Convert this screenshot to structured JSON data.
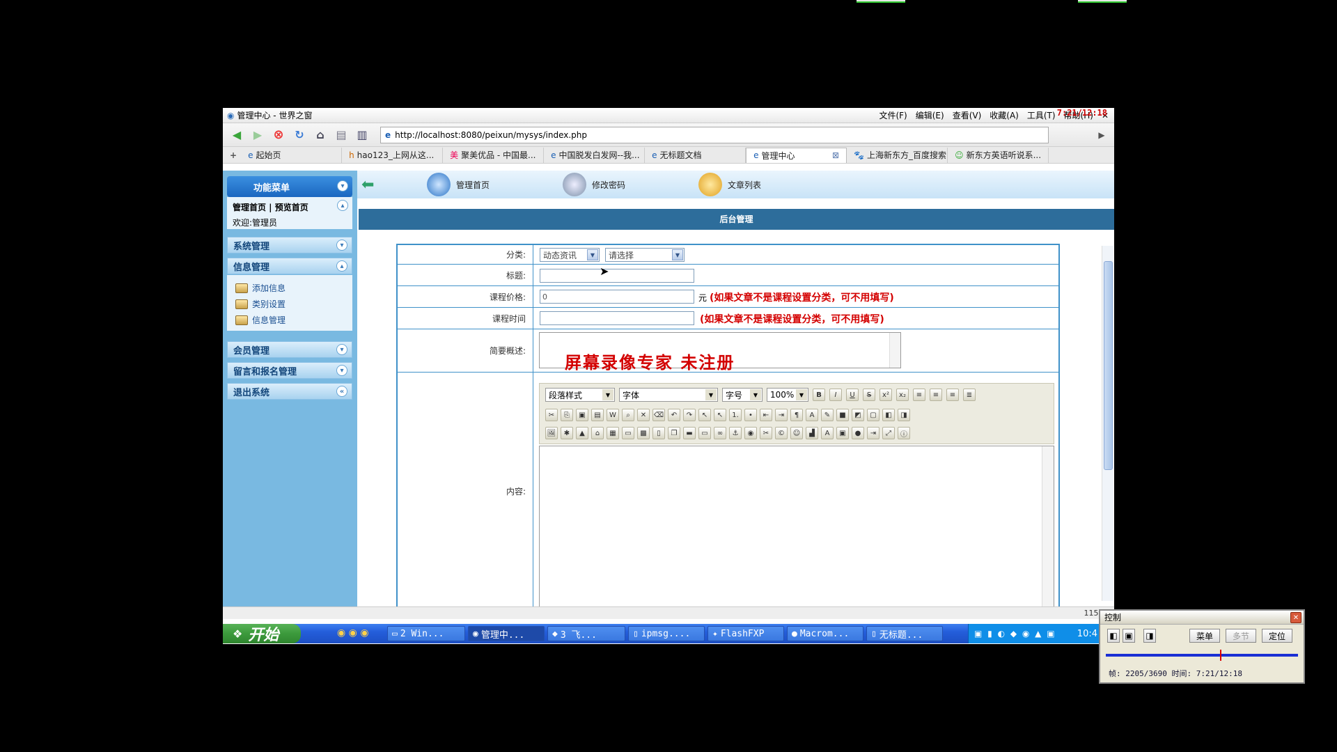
{
  "browser": {
    "window_title": "管理中心 - 世界之窗",
    "menus": [
      "文件(F)",
      "编辑(E)",
      "查看(V)",
      "收藏(A)",
      "工具(T)",
      "帮助(H)"
    ],
    "clock_overlay": "7:21/12:18",
    "url": "http://localhost:8080/peixun/mysys/index.php",
    "tabs": [
      {
        "label": "起始页",
        "active": false
      },
      {
        "label": "hao123_上网从这...",
        "active": false
      },
      {
        "label": "聚美优品 - 中国最...",
        "active": false
      },
      {
        "label": "中国脱发白发网--我...",
        "active": false
      },
      {
        "label": "无标题文档",
        "active": false
      },
      {
        "label": "管理中心",
        "active": true
      },
      {
        "label": "上海新东方_百度搜索",
        "active": false
      },
      {
        "label": "新东方英语听说系...",
        "active": false
      }
    ],
    "status_zoom": "115%"
  },
  "sidebar": {
    "menu_header": "功能菜单",
    "links": "管理首页 | 预览首页",
    "welcome": "欢迎:管理员",
    "sections": [
      {
        "label": "系统管理"
      },
      {
        "label": "信息管理"
      },
      {
        "label": "会员管理"
      },
      {
        "label": "留言和报名管理"
      },
      {
        "label": "退出系统"
      }
    ],
    "info_items": [
      "添加信息",
      "类别设置",
      "信息管理"
    ]
  },
  "topnav": {
    "items": [
      "管理首页",
      "修改密码",
      "文章列表"
    ]
  },
  "banner": "后台管理",
  "form": {
    "category_label": "分类:",
    "category_value": "动态资讯",
    "subcategory_value": "请选择",
    "title_label": "标题:",
    "price_label": "课程价格:",
    "price_value": "0",
    "price_unit": "元",
    "price_note": "(如果文章不是课程设置分类，可不用填写)",
    "time_label": "课程时间",
    "time_note": "(如果文章不是课程设置分类，可不用填写)",
    "summary_label": "简要概述:",
    "content_label": "内容:",
    "watermark": "屏幕录像专家  未注册"
  },
  "editor": {
    "para_style": "段落样式",
    "font": "字体",
    "size": "字号",
    "zoom": "100%"
  },
  "taskbar": {
    "start": "开始",
    "tasks": [
      "2 Win...",
      "管理中...",
      "3 飞...",
      "ipmsg....",
      "FlashFXP",
      "Macrom...",
      "无标题..."
    ],
    "clock": "10:4"
  },
  "control": {
    "title": "控制",
    "menu_btn": "菜单",
    "multi_btn": "多节",
    "locate_btn": "定位",
    "info": "帧: 2205/3690 时间: 7:21/12:18"
  },
  "colors": {
    "sidebar_bg": "#79b9e1",
    "banner_bg": "#2d6d9b",
    "form_border": "#3f91c9",
    "note_red": "#d40000"
  }
}
